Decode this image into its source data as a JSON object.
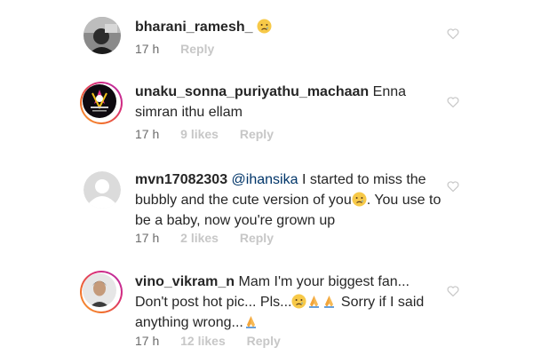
{
  "comments": [
    {
      "username": "bharani_ramesh_",
      "text": "",
      "emoji_suffix": "crying-face",
      "time": "17 h",
      "likes": "",
      "reply": "Reply"
    },
    {
      "username": "unaku_sonna_puriyathu_machaan",
      "text": "Enna simran ithu ellam",
      "time": "17 h",
      "likes": "9 likes",
      "reply": "Reply"
    },
    {
      "username": "mvn17082303",
      "mention": "@ihansika",
      "text_a": "I started to miss the bubbly and the cute version of you",
      "text_b": ". You use to be a baby, now you're grown up",
      "time": "17 h",
      "likes": "2 likes",
      "reply": "Reply"
    },
    {
      "username": "vino_vikram_n",
      "text_a": "Mam I'm your biggest fan... Don't post hot pic... Pls...",
      "text_b": " Sorry if I said anything wrong...",
      "time": "17 h",
      "likes": "12 likes",
      "reply": "Reply"
    }
  ],
  "icons": {
    "like": "heart-outline-icon",
    "emoji_cry": "crying-face",
    "emoji_pray": "folded-hands"
  }
}
